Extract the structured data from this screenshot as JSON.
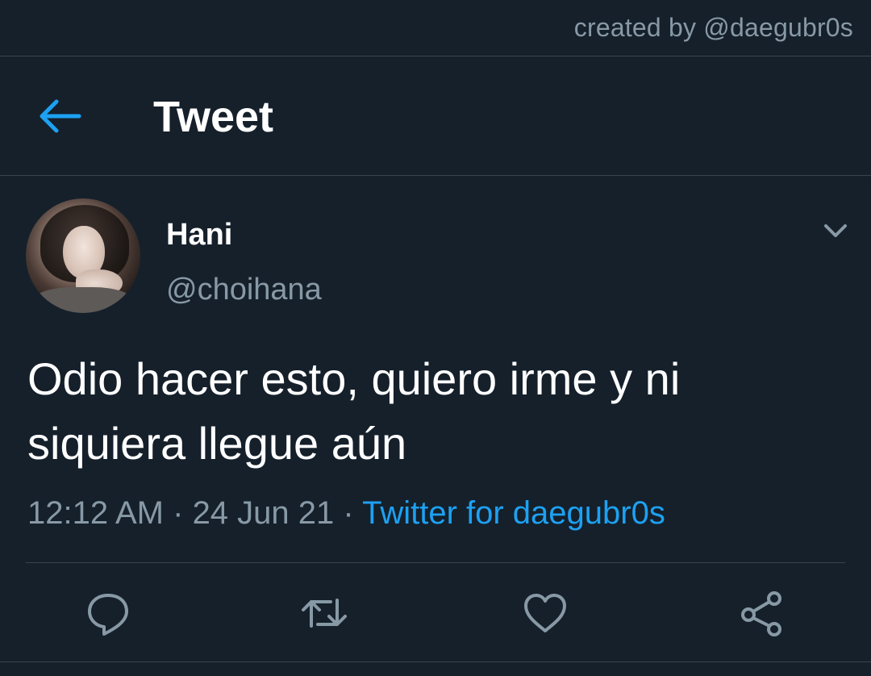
{
  "credit": "created by @daegubr0s",
  "header": {
    "title": "Tweet"
  },
  "tweet": {
    "display_name": "Hani",
    "handle": "@choihana",
    "text": "Odio hacer esto, quiero irme y ni siquiera llegue aún",
    "time": "12:12 AM",
    "separator": " · ",
    "date": "24 Jun 21",
    "source": "Twitter for daegubr0s"
  },
  "icons": {
    "back": "arrow-left-icon",
    "caret": "chevron-down-icon",
    "reply": "reply-icon",
    "retweet": "retweet-icon",
    "like": "heart-icon",
    "share": "share-icon"
  },
  "colors": {
    "background": "#15202b",
    "accent": "#1da1f2",
    "secondary_text": "#8899a6",
    "border": "#38444d"
  }
}
